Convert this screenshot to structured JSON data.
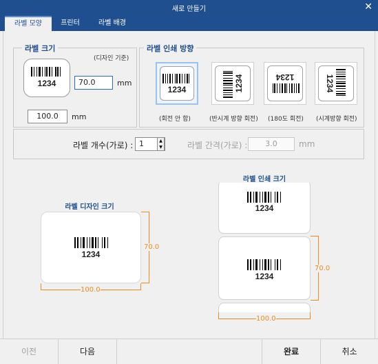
{
  "window": {
    "title": "새로 만들기"
  },
  "tabs": [
    {
      "label": "라벨 모양"
    },
    {
      "label": "프린터"
    },
    {
      "label": "라벨 배경"
    }
  ],
  "label_size": {
    "legend": "라벨 크기",
    "note": "(디자인 기준)",
    "height_value": "70.0",
    "width_value": "100.0",
    "unit": "mm",
    "barcode_text": "1234"
  },
  "print_direction": {
    "legend": "라벨 인쇄 방향",
    "options": [
      {
        "label": "(회전 안 함)",
        "text": "1234"
      },
      {
        "label": "(반시계 방향 회전)",
        "text": "1234"
      },
      {
        "label": "(180도 회전)",
        "text": "1234"
      },
      {
        "label": "(시계방향 회전)",
        "text": "1234"
      }
    ]
  },
  "count": {
    "label": "라벨 개수(가로) :",
    "value": "1"
  },
  "gap": {
    "label": "라벨 간격(가로) :",
    "value": "3.0",
    "unit": "mm"
  },
  "design_preview": {
    "caption": "라벨 디자인 크기",
    "barcode_text": "1234",
    "height": "70.0",
    "width": "100.0"
  },
  "print_preview": {
    "caption": "라벨 인쇄 크기",
    "barcode_text_top": "1234",
    "barcode_text_mid": "1234",
    "height": "70.0",
    "width": "100.0"
  },
  "footer": {
    "prev": "이전",
    "next": "다음",
    "finish": "완료",
    "cancel": "취소"
  },
  "colors": {
    "accent": "#1f4f8f",
    "dimension": "#f08a1a"
  }
}
